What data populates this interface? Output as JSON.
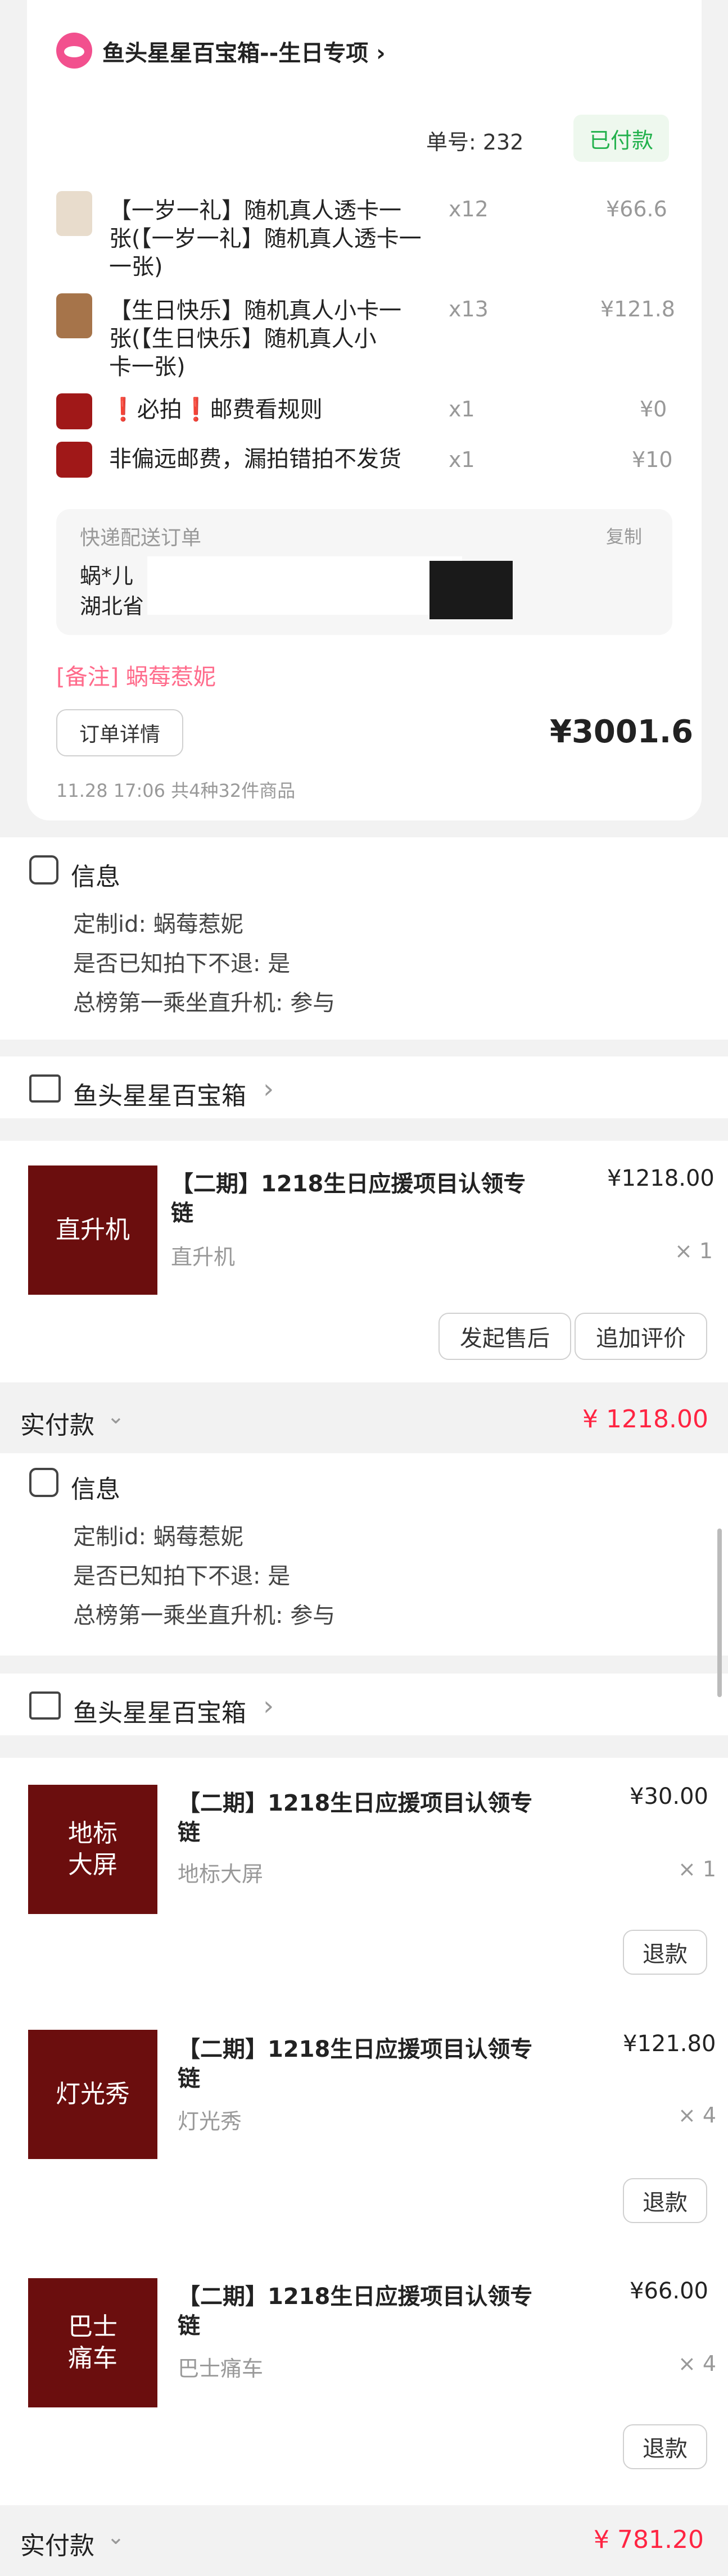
{
  "order": {
    "shop_name": "鱼头星星百宝箱--生日专项 ›",
    "order_no": "单号: 232",
    "status": "已付款",
    "items": [
      {
        "title_line1": "【一岁一礼】随机真人透卡一",
        "title_line2": "张(【一岁一礼】随机真人透卡一",
        "title_line3": "一张)",
        "qty": "x12",
        "price": "¥66.6"
      },
      {
        "title_line1": "【生日快乐】随机真人小卡一",
        "title_line2": "张(【生日快乐】随机真人小",
        "title_line3": "卡一张)",
        "qty": "x13",
        "price": "¥121.8"
      },
      {
        "title": "❗必拍❗邮费看规则",
        "qty": "x1",
        "price": "¥0"
      },
      {
        "title": "非偏远邮费，漏拍错拍不发货",
        "qty": "x1",
        "price": "¥10"
      }
    ],
    "delivery_label": "快递配送订单",
    "copy_label": "复制",
    "receiver_name": "蜗*儿",
    "receiver_province": "湖北省",
    "remark": "[备注] 蜗莓惹妮",
    "detail_button": "订单详情",
    "total": "¥3001.6",
    "meta": "11.28 17:06   共4种32件商品"
  },
  "block1": {
    "info_title": "信息",
    "info_lines": [
      "定制id: 蜗莓惹妮",
      "是否已知拍下不退: 是",
      "总榜第一乘坐直升机: 参与"
    ]
  },
  "block2": {
    "shop_name": "鱼头星星百宝箱",
    "item": {
      "thumb": "直升机",
      "title_line1": "【二期】1218生日应援项目认领专",
      "title_line2": "链",
      "spec": "直升机",
      "price": "¥1218.00",
      "qty": "× 1"
    },
    "btn_after_sale": "发起售后",
    "btn_review": "追加评价",
    "paid_label": "实付款",
    "paid_amount": "¥ 1218.00",
    "info_title": "信息",
    "info_lines": [
      "定制id: 蜗莓惹妮",
      "是否已知拍下不退: 是",
      "总榜第一乘坐直升机: 参与"
    ]
  },
  "block3": {
    "shop_name": "鱼头星星百宝箱",
    "items": [
      {
        "thumb_l1": "地标",
        "thumb_l2": "大屏",
        "title_line1": "【二期】1218生日应援项目认领专",
        "title_line2": "链",
        "spec": "地标大屏",
        "price": "¥30.00",
        "qty": "× 1",
        "btn": "退款"
      },
      {
        "thumb_l1": "灯光秀",
        "thumb_l2": "",
        "title_line1": "【二期】1218生日应援项目认领专",
        "title_line2": "链",
        "spec": "灯光秀",
        "price": "¥121.80",
        "qty": "× 4",
        "btn": "退款"
      },
      {
        "thumb_l1": "巴士",
        "thumb_l2": "痛车",
        "title_line1": "【二期】1218生日应援项目认领专",
        "title_line2": "链",
        "spec": "巴士痛车",
        "price": "¥66.00",
        "qty": "× 4",
        "btn": "退款"
      }
    ],
    "paid_label": "实付款",
    "paid_amount": "¥ 781.20"
  },
  "colors": {
    "accent_red": "#ff2442",
    "thumb_dark": "#6b0e0e",
    "status_green": "#22b14c"
  }
}
